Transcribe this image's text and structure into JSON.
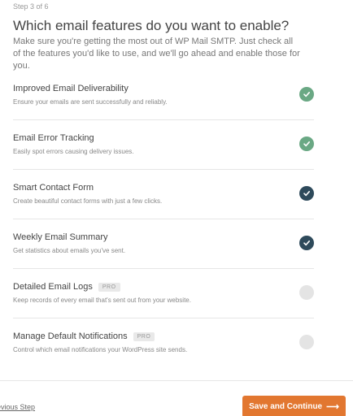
{
  "header": {
    "step": "Step 3 of 6",
    "title": "Which email features do you want to enable?",
    "intro": "Make sure you're getting the most out of WP Mail SMTP. Just check all of the features you'd like to use, and we'll go ahead and enable those for you."
  },
  "features": [
    {
      "title": "Improved Email Deliverability",
      "desc": "Ensure your emails are sent successfully and reliably.",
      "checked": true,
      "color": "#6aa884",
      "pro": ""
    },
    {
      "title": "Email Error Tracking",
      "desc": "Easily spot errors causing delivery issues.",
      "checked": true,
      "color": "#6aa884",
      "pro": ""
    },
    {
      "title": "Smart Contact Form",
      "desc": "Create beautiful contact forms with just a few clicks.",
      "checked": true,
      "color": "#2e4a5b",
      "pro": ""
    },
    {
      "title": "Weekly Email Summary",
      "desc": "Get statistics about emails you've sent.",
      "checked": true,
      "color": "#2e4a5b",
      "pro": ""
    },
    {
      "title": "Detailed Email Logs",
      "desc": "Keep records of every email that's sent out from your website.",
      "checked": false,
      "color": "#e4e4e4",
      "pro": "PRO"
    },
    {
      "title": "Manage Default Notifications",
      "desc": "Control which email notifications your WordPress site sends.",
      "checked": false,
      "color": "#e4e4e4",
      "pro": "PRO"
    }
  ],
  "footer": {
    "previous_label": "Previous Step",
    "previous_visible": "evious Step",
    "continue_label": "Save and Continue",
    "continue_icon": "arrow-right-icon",
    "accent": "#e27730"
  }
}
